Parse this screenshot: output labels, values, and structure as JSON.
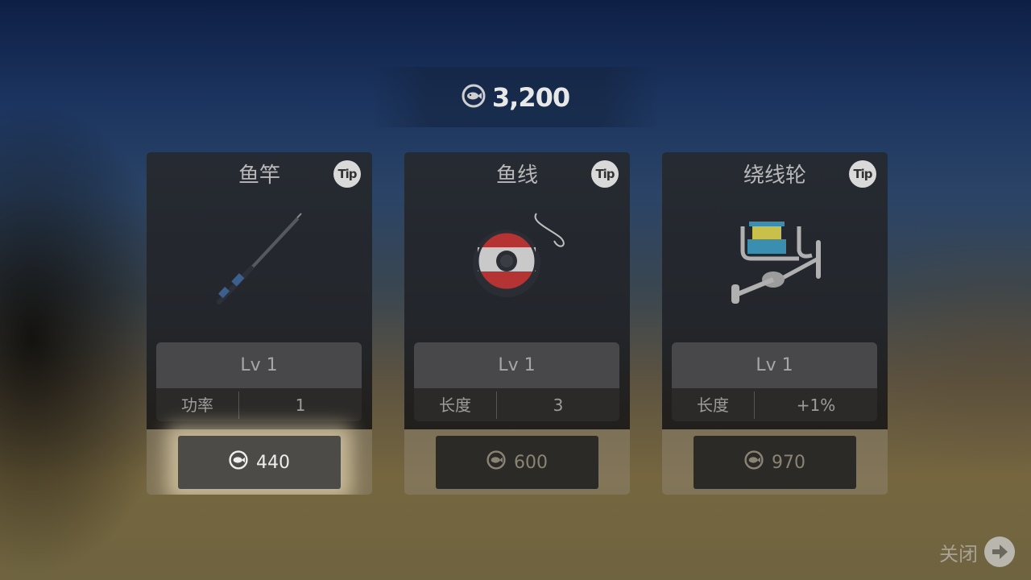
{
  "currency": {
    "icon": "fish-coin-icon",
    "amount": "3,200"
  },
  "cards": [
    {
      "title": "鱼竿",
      "tip": "Tip",
      "icon": "fishing-rod-icon",
      "level": "Lv 1",
      "stat_label": "功率",
      "stat_value": "1",
      "price": "440",
      "highlighted": true
    },
    {
      "title": "鱼线",
      "tip": "Tip",
      "icon": "fishing-line-spool-icon",
      "level": "Lv 1",
      "stat_label": "长度",
      "stat_value": "3",
      "price": "600",
      "highlighted": false
    },
    {
      "title": "绕线轮",
      "tip": "Tip",
      "icon": "fishing-reel-icon",
      "level": "Lv 1",
      "stat_label": "长度",
      "stat_value": "+1%",
      "price": "970",
      "highlighted": false
    }
  ],
  "close": {
    "label": "关闭",
    "icon": "arrow-right-icon"
  },
  "colors": {
    "highlight_glow": "#fff0c8",
    "spool_red": "#b53333"
  }
}
